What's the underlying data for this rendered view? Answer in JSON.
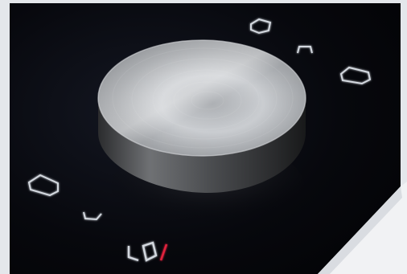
{
  "panel": {
    "indicator_low_label": "LO",
    "indicator_color": "#d3d8df",
    "accent_color": "#e0213d",
    "glass_color": "#06070b",
    "knob_color": "#b9bcc0",
    "border_color": "#e8eaee"
  },
  "icons": [
    "square-indicator-icon",
    "corner-indicator-icon",
    "square-indicator-icon",
    "square-indicator-icon",
    "corner-indicator-icon",
    "lo-indicator-icon",
    "power-indicator-icon"
  ]
}
